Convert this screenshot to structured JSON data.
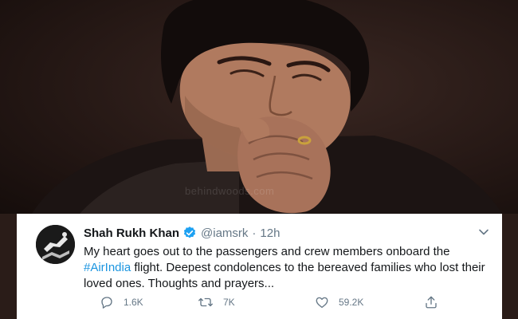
{
  "tweet": {
    "display_name": "Shah Rukh Khan",
    "handle": "@iamsrk",
    "separator": "·",
    "time": "12h",
    "text_part1": "My heart goes out to the passengers and crew members onboard the ",
    "hashtag": "#AirIndia",
    "text_part2": " flight. Deepest condolences to the bereaved families who lost their loved ones. Thoughts and prayers...",
    "replies": "1.6K",
    "retweets": "7K",
    "likes": "59.2K",
    "verified": true
  },
  "icons": [
    "verified-badge-icon",
    "chevron-down-icon",
    "reply-icon",
    "retweet-icon",
    "like-icon",
    "share-icon"
  ],
  "colors": {
    "accent": "#1b95e0",
    "secondary_text": "#657786",
    "primary_text": "#14171a"
  },
  "watermark": "behindwoods.com"
}
